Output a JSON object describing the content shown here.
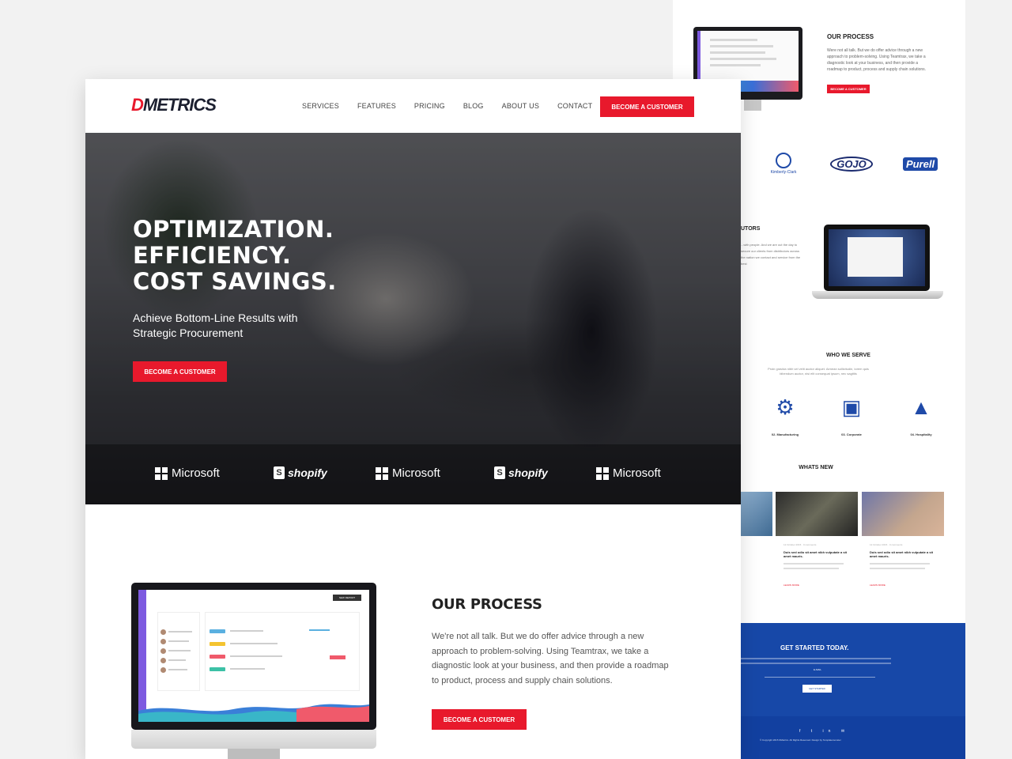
{
  "back_page": {
    "process_title": "OUR PROCESS",
    "process_text": "Were not all talk. But we do offer advice through a new approach to problem-solving. Using Teamtrax, we take a diagnostic look at your business, and then provide a roadmap to product, process and supply chain solutions.",
    "process_button": "BECOME A CUSTOMER",
    "client_logos": [
      "Kimberly-Clark",
      "GOJO",
      "Purell"
    ],
    "distributors_title": "UTORS",
    "distributors_text": "...with people. And we are out the day to secure our clients from distributors across the nation we contact and service from the best",
    "serve_title": "WHO WE SERVE",
    "serve_text": "Proin gravida nibh vel velit auctor aliquet. Aenean sollicitudin, lorem quis bibendum auctor, nisi elit consequat ipsum, nec sagittis",
    "serve_items": [
      {
        "label": "02. Manufacturing",
        "icon": "factory-worker-icon"
      },
      {
        "label": "03. Corporate",
        "icon": "presentation-board-icon"
      },
      {
        "label": "04. Hospitality",
        "icon": "service-bell-icon"
      }
    ],
    "news_title": "WHATS NEW",
    "news": [
      {
        "meta": "12 October 2015 · 0 comments",
        "headline": "Duis sed odio sit amet nibh vulputate a sit amet mauris.",
        "more": "LEARN MORE"
      },
      {
        "meta": "12 October 2015 · 0 comments",
        "headline": "Duis sed odio sit amet nibh vulputate a sit amet mauris.",
        "more": "LEARN MORE"
      }
    ],
    "cta_title": "GET STARTED TODAY.",
    "cta_input": "E-MAIL",
    "cta_button": "GET STARTED",
    "footer_social": "f t in ✉",
    "footer_copy": "© Copyright 2015 DMetrics. All Rights Reserved. Design by Templatemonster"
  },
  "front_page": {
    "logo_prefix": "D",
    "logo_rest": "METRICS",
    "nav": [
      "SERVICES",
      "FEATURES",
      "PRICING",
      "BLOG",
      "ABOUT US",
      "CONTACT"
    ],
    "header_button": "BECOME A CUSTOMER",
    "hero": {
      "line1": "OPTIMIZATION.",
      "line2": "EFFICIENCY.",
      "line3": "COST SAVINGS.",
      "subtitle": "Achieve Bottom-Line Results with Strategic Procurement",
      "button": "BECOME A CUSTOMER"
    },
    "brands": [
      "Microsoft",
      "shopify",
      "Microsoft",
      "shopify",
      "Microsoft"
    ],
    "monitor_top_button": "NEW REPORT",
    "process": {
      "title": "OUR PROCESS",
      "text": "We're not all talk. But we do offer advice through a new approach to problem-solving. Using Teamtrax, we take a diagnostic look at your business, and then provide a roadmap to product, process and supply chain solutions.",
      "button": "BECOME A CUSTOMER"
    }
  },
  "colors": {
    "accent_red": "#e8192c",
    "brand_blue": "#1748a8",
    "dark_text": "#222222"
  }
}
